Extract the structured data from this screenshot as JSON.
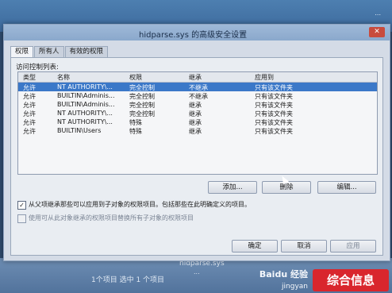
{
  "window": {
    "title": "hidparse.sys 的高级安全设置",
    "close_symbol": "✕"
  },
  "tabs": [
    {
      "label": "权限",
      "active": true
    },
    {
      "label": "所有人",
      "active": false
    },
    {
      "label": "有效的权限",
      "active": false
    }
  ],
  "permissions": {
    "list_label": "访问控制列表:",
    "columns": [
      "类型",
      "名称",
      "权限",
      "继承",
      "应用到"
    ],
    "rows": [
      {
        "type": "允许",
        "name": "NT AUTHORITY\\...",
        "permission": "完全控制",
        "inherit": "不继承",
        "apply_to": "只有该文件夹",
        "selected": true
      },
      {
        "type": "允许",
        "name": "BUILTIN\\Adminis...",
        "permission": "完全控制",
        "inherit": "不继承",
        "apply_to": "只有该文件夹",
        "selected": false
      },
      {
        "type": "允许",
        "name": "BUILTIN\\Adminis...",
        "permission": "完全控制",
        "inherit": "继承",
        "apply_to": "只有该文件夹",
        "selected": false
      },
      {
        "type": "允许",
        "name": "NT AUTHORITY\\...",
        "permission": "完全控制",
        "inherit": "继承",
        "apply_to": "只有该文件夹",
        "selected": false
      },
      {
        "type": "允许",
        "name": "NT AUTHORITY\\...",
        "permission": "特殊",
        "inherit": "继承",
        "apply_to": "只有该文件夹",
        "selected": false
      },
      {
        "type": "允许",
        "name": "BUILTIN\\Users",
        "permission": "特殊",
        "inherit": "继承",
        "apply_to": "只有该文件夹",
        "selected": false
      }
    ],
    "add_label": "添加...",
    "remove_label": "删除",
    "edit_label": "编辑..."
  },
  "options": {
    "inherit_checkbox_label": "从父项继承那些可以应用到子对象的权限项目。包括那些在此明确定义的项目。",
    "inherit_checked": true,
    "replace_checkbox_label": "使用可从此对象继承的权限项目替换所有子对象的权限项目",
    "replace_checked": false,
    "check_mark": "✓"
  },
  "footer": {
    "ok_label": "确定",
    "cancel_label": "取消",
    "apply_label": "应用"
  },
  "explorer": {
    "status_text": "1个项目   选中 1 个项目",
    "file_name": "hidparse.sys",
    "file_detail": "...",
    "corner_text": "..."
  },
  "watermark": {
    "baidu": "Baidu 经验",
    "baidu_sub": "jingyan",
    "brand": "综合信息"
  },
  "colors": {
    "selection": "#3b78c8",
    "watermark": "#d9262d"
  }
}
